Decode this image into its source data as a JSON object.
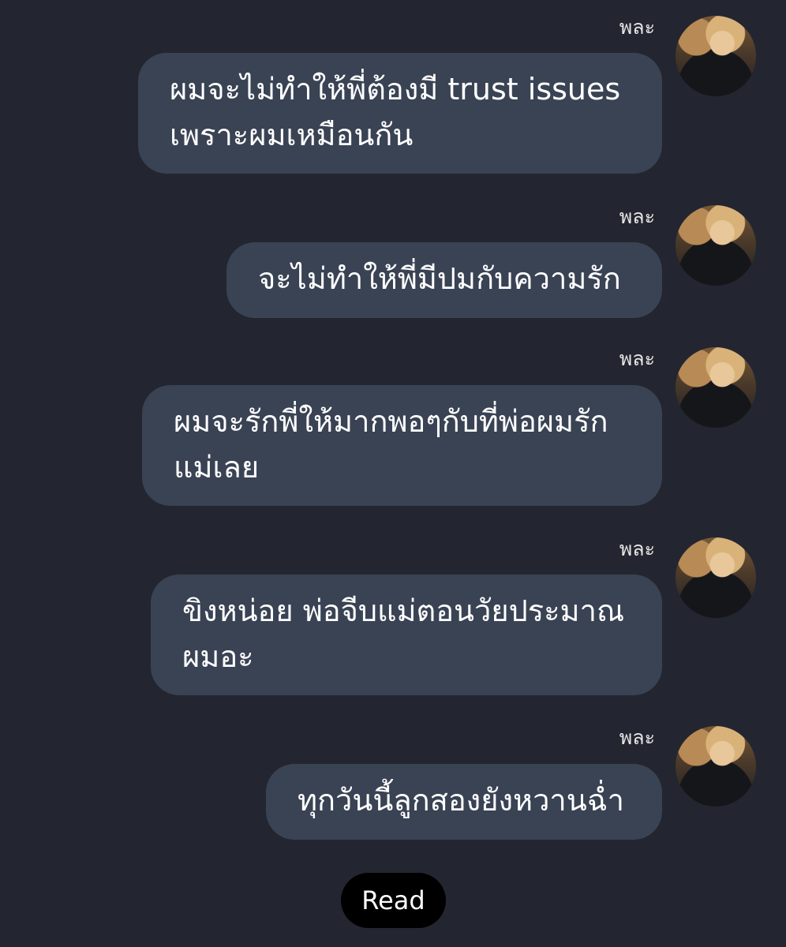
{
  "messages": [
    {
      "sender": "พละ",
      "text": "ผมจะไม่ทำให้พี่ต้องมี trust issues\nเพราะผมเหมือนกัน"
    },
    {
      "sender": "พละ",
      "text": "จะไม่ทำให้พี่มีปมกับความรัก"
    },
    {
      "sender": "พละ",
      "text": "ผมจะรักพี่ให้มากพอๆกับที่พ่อผมรัก\nแม่เลย"
    },
    {
      "sender": "พละ",
      "text": "ขิงหน่อย พ่อจีบแม่ตอนวัยประมาณ\nผมอะ"
    },
    {
      "sender": "พละ",
      "text": "ทุกวันนี้ลูกสองยังหวานฉ่ำ"
    }
  ],
  "status": {
    "read_label": "Read"
  }
}
